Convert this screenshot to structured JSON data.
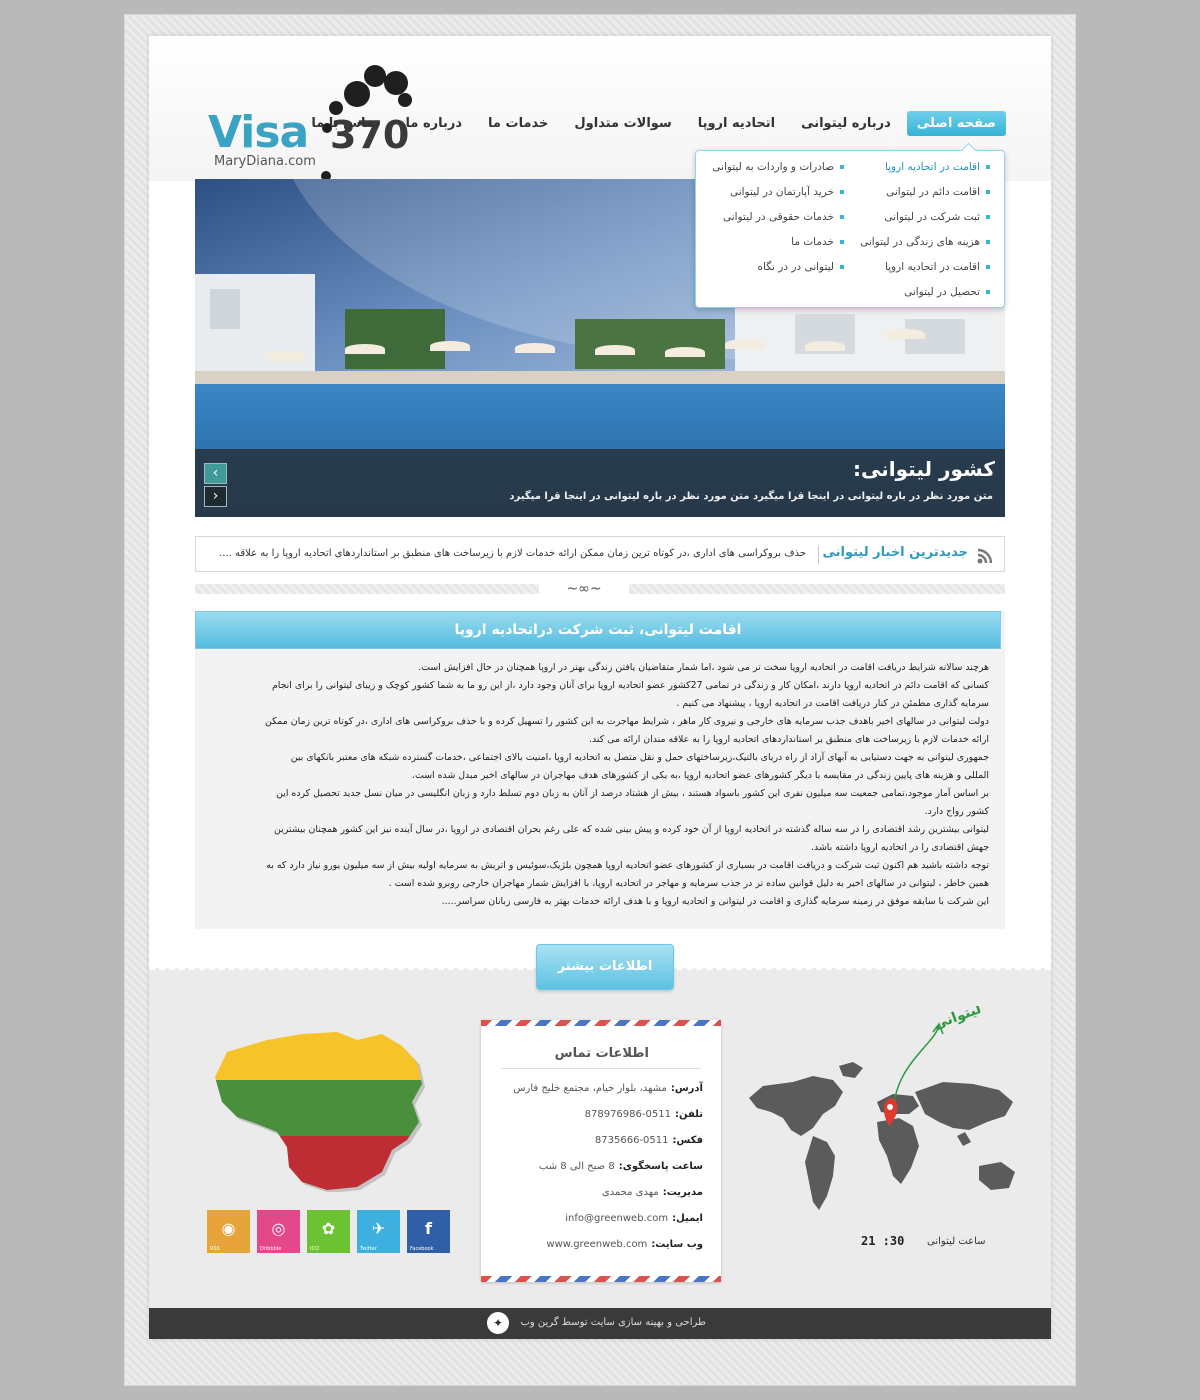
{
  "logo": {
    "word": "Visa",
    "number": "370",
    "subtitle": "MaryDiana.com"
  },
  "nav": [
    "صفحه اصلی",
    "درباره لیتوانی",
    "اتحادیه اروپا",
    "سوالات متداول",
    "خدمات ما",
    "درباره ما",
    "تماس با ما"
  ],
  "dropdown": {
    "right": [
      "اقامت در اتحادیه اروپا",
      "اقامت دائم در لیتوانی",
      "ثبت شرکت در لیتوانی",
      "هزینه های زندگی در لیتوانی",
      "اقامت در اتحادیه اروپا",
      "تحصیل در لیتوانی"
    ],
    "left": [
      "صادرات و واردات به لیتوانی",
      "خرید آپارتمان در لیتوانی",
      "خدمات حقوقی در لیتوانی",
      "خدمات ما",
      "لیتوانی در در نگاه"
    ]
  },
  "hero": {
    "title": "کشور لیتوانی:",
    "text": "متن مورد نظر در باره لیتوانی در اینجا قرا میگیرد متن مورد نظر در باره لیتوانی در اینجا قرا میگیرد"
  },
  "news": {
    "title": "جدیدترین اخبار لیتوانی",
    "text": "حذف بروکراسی های اداری ،در کوتاه ترین زمان ممکن ارائه خدمات لازم با زیرساخت های منطبق بر استانداردهای اتحادیه اروپا را به علاقه ...."
  },
  "article": {
    "title": "اقامت لیتوانی، ثبت شرکت دراتحادیه اروپا",
    "lines": [
      "هرچند سالانه شرایط دریافت اقامت در اتحادیه اروپا سخت تر می شود ،اما شمار متقاضیان یافتن زندگی بهتر در اروپا همچنان در حال افزایش است.",
      "کسانی که اقامت دائم در اتحادیه اروپا دارند ،امکان کار و زندگی در تمامی 27کشور عضو اتحادیه اروپا برای آنان وجود دارد ،از این رو ما به شما کشور کوچک و زیبای لیتوانی را برای انجام",
      "سرمایه گذاری مطمئن در کنار دریافت اقامت در اتحادیه اروپا ، پیشنهاد می کنیم .",
      "دولت لیتوانی در سالهای اخیر  باهدف جذب سرمایه های خارجی و نیروی کار ماهر ، شرایط مهاجرت به این کشور را تسهیل کرده و با حذف بروکراسی های اداری ،در کوتاه ترین زمان ممکن",
      "ارائه خدمات لازم با زیرساخت های منطبق بر استانداردهای اتحادیه اروپا را به علاقه مندان ارائه می کند.",
      "جمهوری لیتوانی به جهت دستیابی به آبهای آزاد از راه دریای بالتیک،زیرساختهای حمل و نقل متصل به اتحادیه اروپا ،امنیت بالای اجتماعی ،خدمات گسترده شبکه های معتبر بانکهای بین",
      "المللی و هزینه های پایین زندگی در مقایسه با دیگر کشورهای عضو اتحادیه اروپا ،به یکی از کشورهای هدف مهاجران در سالهای اخیر مبدل شده است.",
      "بر اساس آمار موجود،تمامی جمعیت سه میلیون نفری این کشور باسواد هستند ، بیش از هشتاد درصد از آنان به زبان دوم تسلط دارد و  زبان انگلیسی در میان نسل جدید تحصیل کرده این",
      "کشور رواج دارد.",
      "لیتوانی بیشترین رشد اقتصادی را در سه ساله گذشته در اتحادیه اروپا از آن خود کرده و پیش بینی شده که علی رغم بحران اقتصادی در اروپا ،در سال آینده نیز این کشور همچنان بیشترین",
      "جهش اقتصادی را در اتحادیه اروپا داشته باشد.",
      "توجه داشته باشید هم اکنون ثبت شرکت و دریافت اقامت در بسیاری از کشورهای عضو اتحادیه اروپا همچون بلژیک،سوئیس و اتریش به سرمایه اولیه بیش از سه میلیون یورو نیاز دارد که به",
      "همین خاطر ، لیتوانی در سالهای اخیر به دلیل قوانین ساده تر در جذب سرمایه و مهاجر در اتحادیه اروپا، با افزایش شمار مهاجران خارجی روبرو شده است .",
      "این شرکت با سابقه موفق در زمینه سرمایه گذاری و اقامت در لیتوانی و اتحادیه اروپا و با هدف ارائه خدمات بهتر به فارسی زبانان سراسر....."
    ]
  },
  "more_button": "اطلاعات بیشتر",
  "contact": {
    "title": "اطلاعات تماس",
    "rows": [
      {
        "label": "آدرس:",
        "value": "مشهد، بلوار خیام، مجتمع خلیج فارس"
      },
      {
        "label": "تلفن:",
        "value": "0511-878976986"
      },
      {
        "label": "فکس:",
        "value": "0511-8735666"
      },
      {
        "label": "ساعت پاسخگوی:",
        "value": "8 صبح الی 8 شب"
      },
      {
        "label": "مدیریت:",
        "value": "مهدی محمدی"
      },
      {
        "label": "ایمیل:",
        "value": "info@greenweb.com"
      },
      {
        "label": "وب سایت:",
        "value": "www.greenweb.com"
      }
    ]
  },
  "socials": [
    {
      "name": "RSS",
      "color": "#e8a43a",
      "glyph": "◉"
    },
    {
      "name": "Dribbble",
      "color": "#e4488a",
      "glyph": "◎"
    },
    {
      "name": "ICQ",
      "color": "#6cc232",
      "glyph": "✿"
    },
    {
      "name": "Twitter",
      "color": "#3db0df",
      "glyph": "✈"
    },
    {
      "name": "Facebook",
      "color": "#2f5fa6",
      "glyph": "f"
    }
  ],
  "map": {
    "label": "لیتوانی",
    "clock": "21 :30",
    "clock_label": "ساعت لیتوانی"
  },
  "footer": {
    "text": "طراحی و بهینه سازی سایت توسط گرین وب"
  },
  "colors": {
    "accent": "#35b3d7",
    "flag_yellow": "#f6c42a",
    "flag_green": "#4a8f3c",
    "flag_red": "#be2d33"
  }
}
